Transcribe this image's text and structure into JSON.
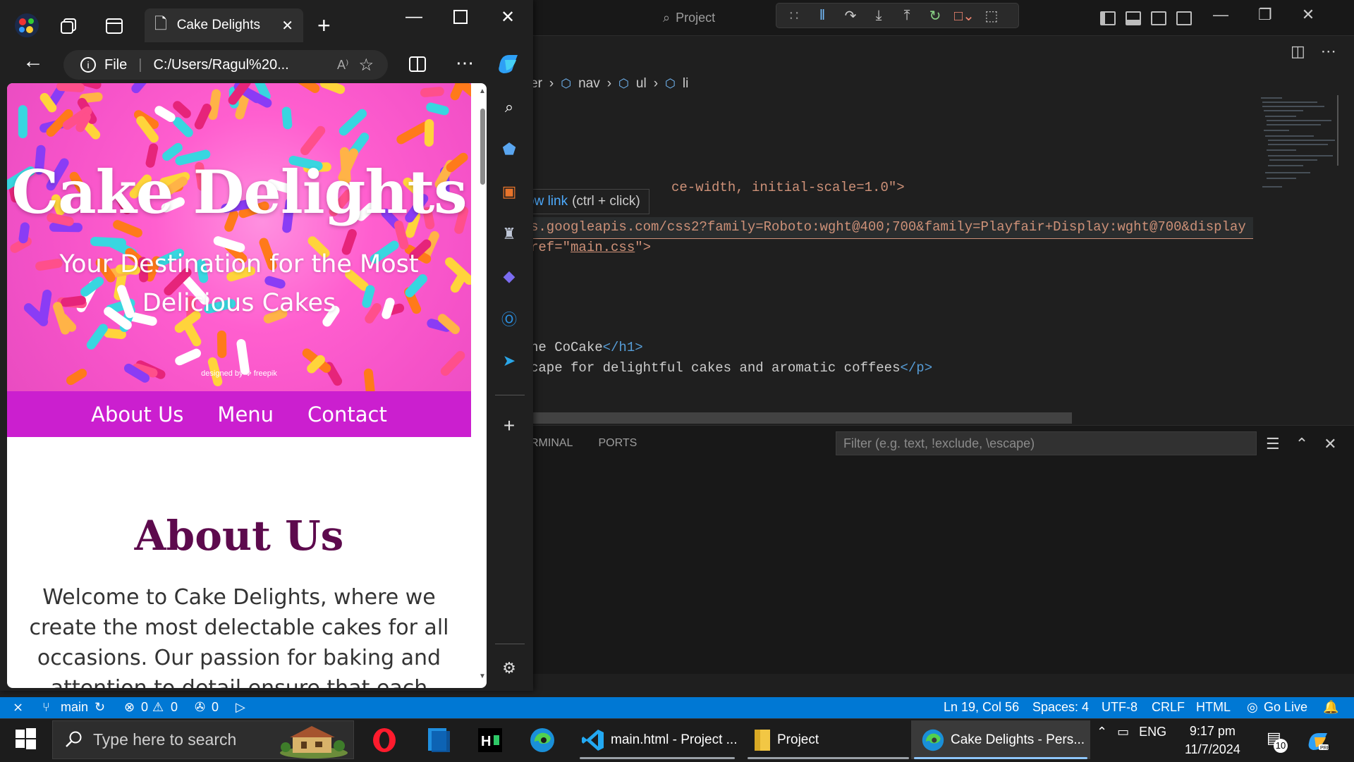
{
  "vscode": {
    "command_center": "Project",
    "breadcrumb": [
      "er",
      "nav",
      "ul",
      "li"
    ],
    "code_lines": [
      {
        "pre": "",
        "text": "ce-width, initial-scale=1.0\">"
      },
      {
        "pre": "",
        "text": "s.googleapis.com/css2?family=Roboto:wght@400;700&family=Playfair+Display:wght@700&display"
      },
      {
        "pre": "ref=\"",
        "link": "main.css",
        "post": "\">"
      },
      {
        "pre": "ne CoCake",
        "close": "</h1>"
      },
      {
        "pre": "cape for delightful cakes and aromatic coffees",
        "close": "</p>"
      }
    ],
    "tooltip": {
      "link": "ow link",
      "hint": "(ctrl + click)"
    },
    "panel_tabs": [
      "RMINAL",
      "PORTS"
    ],
    "filter_placeholder": "Filter (e.g. text, !exclude, \\escape)",
    "statusbar": {
      "branch": "main",
      "errors": "0",
      "warnings": "0",
      "ports": "0",
      "cursor": "Ln 19, Col 56",
      "spaces": "Spaces: 4",
      "encoding": "UTF-8",
      "eol": "CRLF",
      "language": "HTML",
      "golive": "Go Live"
    }
  },
  "edge": {
    "tab_title": "Cake Delights",
    "addr_scheme": "File",
    "addr_url": "C:/Users/Ragul%20...",
    "page": {
      "hero_title": "Cake Delights",
      "hero_subtitle": "Your Destination for the Most Delicious Cakes",
      "credit": "designed by ❉ freepik",
      "nav": [
        "About Us",
        "Menu",
        "Contact"
      ],
      "about_title": "About Us",
      "about_text": "Welcome to Cake Delights, where we create the most delectable cakes for all occasions. Our passion for baking and attention to detail ensure that each cake"
    }
  },
  "taskbar": {
    "search_placeholder": "Type here to search",
    "apps": [
      {
        "name": "opera-icon",
        "label": ""
      },
      {
        "name": "file-icon",
        "label": ""
      },
      {
        "name": "hackerrank-icon",
        "label": ""
      },
      {
        "name": "edge-icon",
        "label": ""
      },
      {
        "name": "vscode",
        "label": "main.html - Project ..."
      },
      {
        "name": "explorer",
        "label": "Project"
      },
      {
        "name": "edge-window",
        "label": "Cake Delights - Pers..."
      }
    ],
    "language": "ENG",
    "time": "9:17 pm",
    "date": "11/7/2024",
    "notifications": "10"
  },
  "colors": {
    "accent": "#0078d4",
    "nav": "#cb1fcf",
    "hero": "#f552c8",
    "heading": "#5d0a4d"
  }
}
